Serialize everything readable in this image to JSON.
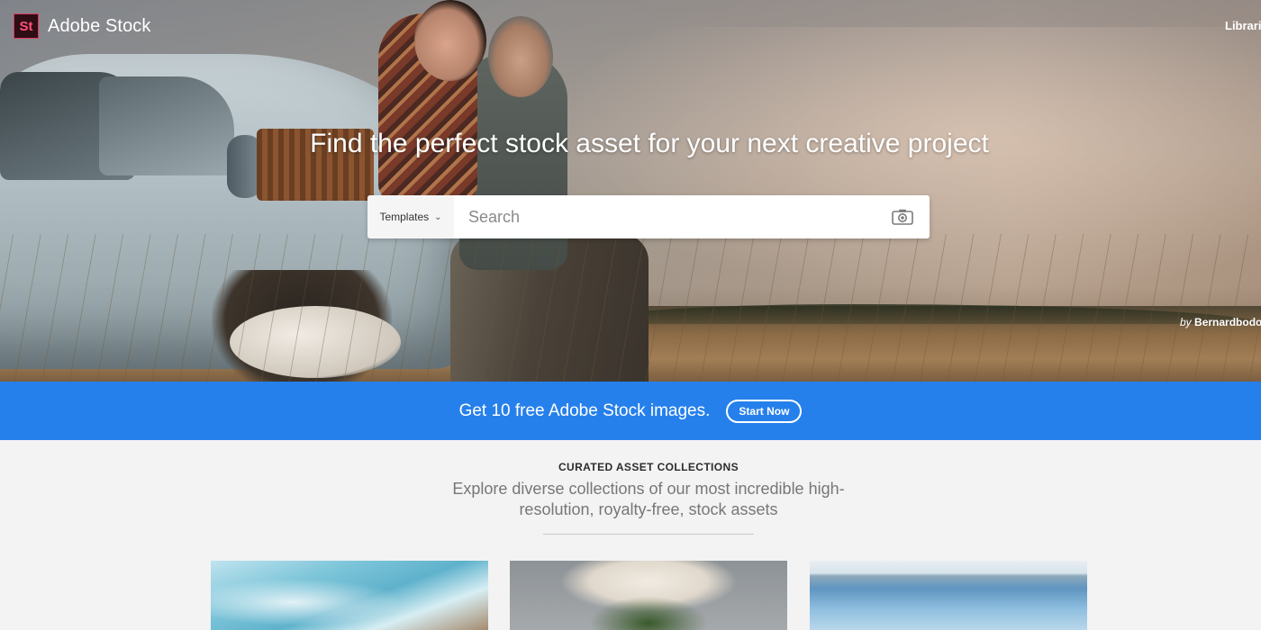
{
  "header": {
    "logo_mark": "St",
    "logo_text": "Adobe Stock",
    "libraries_label": "Libraries"
  },
  "hero": {
    "title": "Find the perfect stock asset for your next creative project",
    "search": {
      "type_label": "Templates",
      "placeholder": "Search"
    },
    "credit_by": "by",
    "credit_name": "Bernardbodo"
  },
  "promo": {
    "text": "Get 10 free Adobe Stock images.",
    "button_label": "Start Now"
  },
  "collections": {
    "label": "CURATED ASSET COLLECTIONS",
    "subtitle": "Explore diverse collections of our most incredible high-resolution, royalty-free, stock assets"
  },
  "colors": {
    "promo_blue": "#2680eb",
    "logo_pink": "#ff4f7a",
    "logo_bg": "#2e0d14"
  },
  "icons": [
    "camera-icon",
    "chevron-down-icon"
  ]
}
